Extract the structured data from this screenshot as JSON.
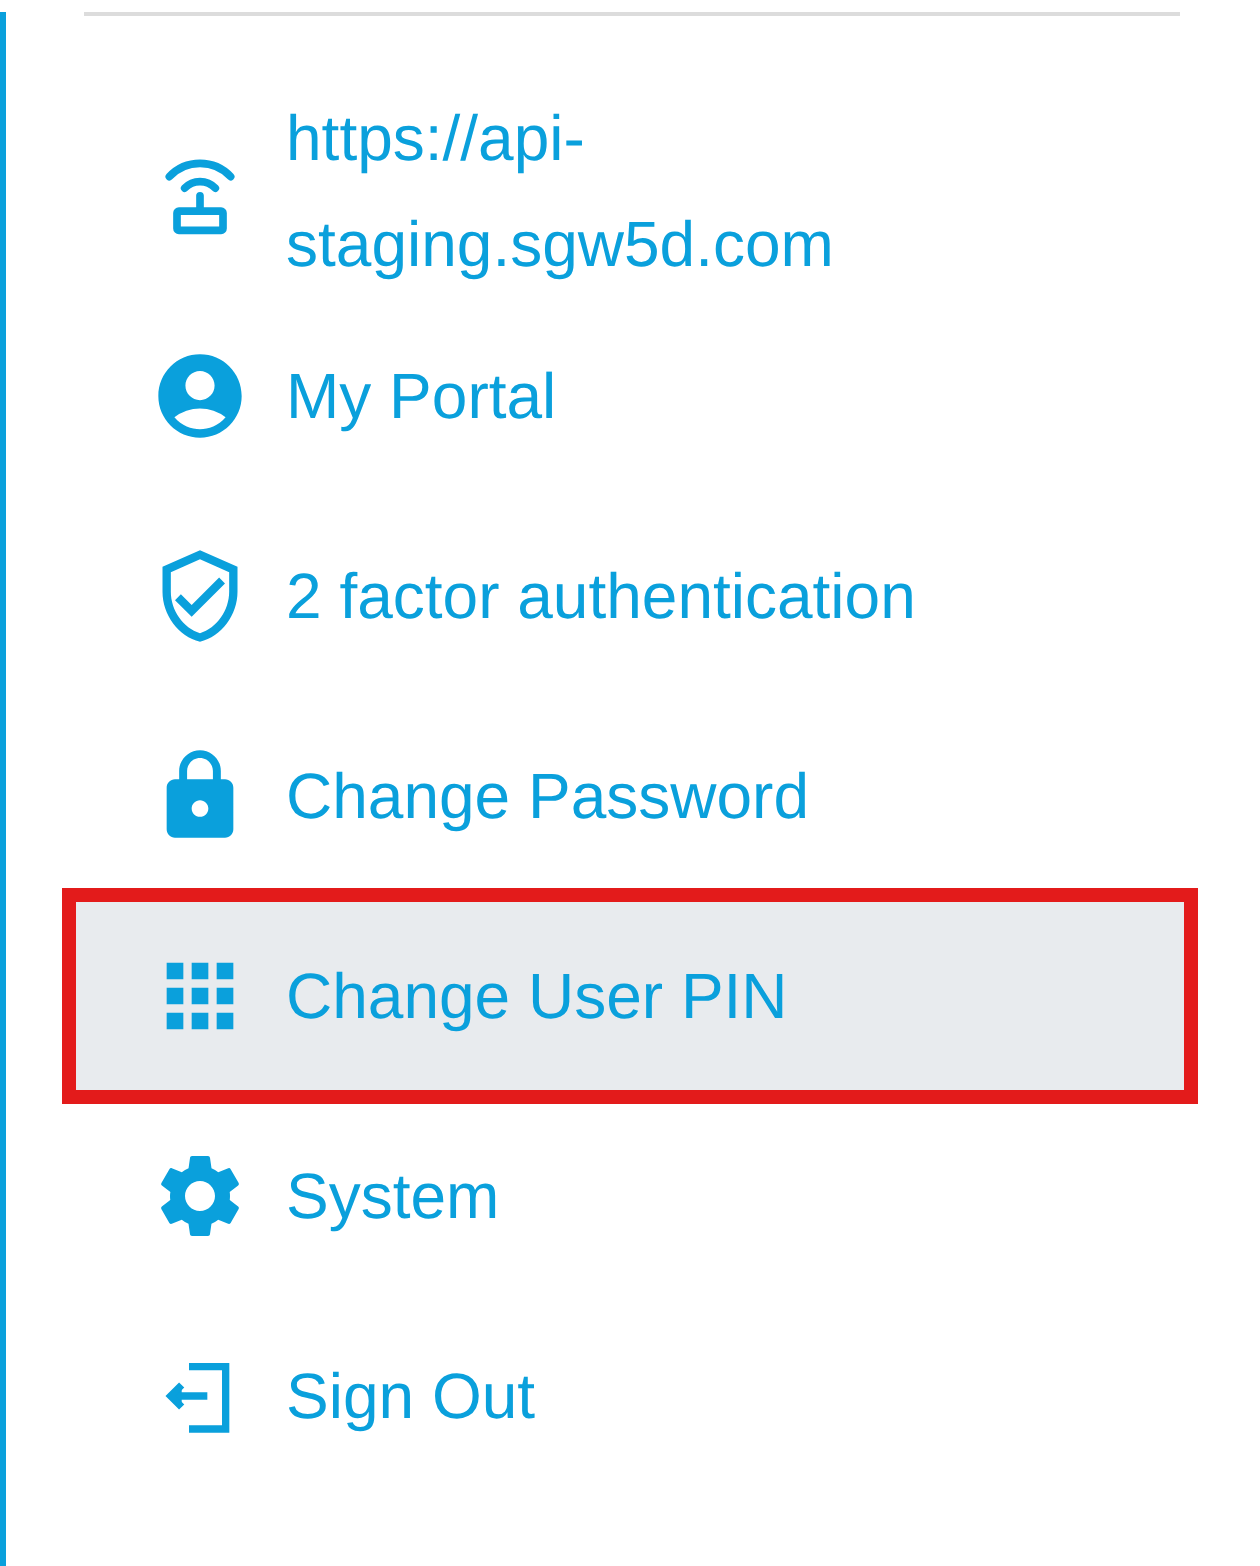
{
  "menu": {
    "items": [
      {
        "kind": "info",
        "label": "https://api-staging.sgw5d.com"
      },
      {
        "kind": "link",
        "label": "My Portal",
        "selected": false
      },
      {
        "kind": "link",
        "label": "2 factor authentication",
        "selected": false
      },
      {
        "kind": "link",
        "label": "Change Password",
        "selected": false
      },
      {
        "kind": "link",
        "label": "Change User PIN",
        "selected": true
      },
      {
        "kind": "link",
        "label": "System",
        "selected": false
      },
      {
        "kind": "link",
        "label": "Sign Out",
        "selected": false
      }
    ]
  }
}
